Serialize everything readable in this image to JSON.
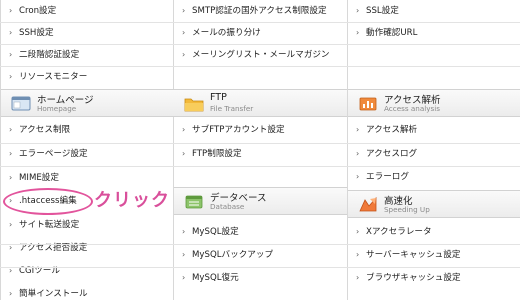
{
  "col1": {
    "items_top": [
      "Cron設定",
      "SSH設定",
      "二段階認証設定",
      "リソースモニター"
    ],
    "section_homepage": {
      "title": "ホームページ",
      "subtitle": "Homepage",
      "icon": "homepage-icon"
    },
    "items_homepage": [
      "アクセス制限",
      "エラーページ設定",
      "MIME設定",
      ".htaccess編集",
      "サイト転送設定",
      "アクセス拒否設定",
      "CGIツール",
      "簡単インストール"
    ]
  },
  "col2": {
    "items_top": [
      "SMTP認証の国外アクセス制限設定",
      "メールの振り分け",
      "メーリングリスト・メールマガジン"
    ],
    "section_ftp": {
      "title": "FTP",
      "subtitle": "File Transfer",
      "icon": "folder-icon"
    },
    "items_ftp": [
      "サブFTPアカウント設定",
      "FTP制限設定"
    ],
    "section_db": {
      "title": "データベース",
      "subtitle": "Database",
      "icon": "database-icon"
    },
    "items_db": [
      "MySQL設定",
      "MySQLバックアップ",
      "MySQL復元"
    ]
  },
  "col3": {
    "items_top": [
      "SSL設定",
      "動作確認URL"
    ],
    "section_access": {
      "title": "アクセス解析",
      "subtitle": "Access analysis",
      "icon": "chart-icon"
    },
    "items_access": [
      "アクセス解析",
      "アクセスログ",
      "エラーログ"
    ],
    "section_speed": {
      "title": "高速化",
      "subtitle": "Speeding Up",
      "icon": "speed-icon"
    },
    "items_speed": [
      "Xアクセラレータ",
      "サーバーキャッシュ設定",
      "ブラウザキャッシュ設定"
    ]
  },
  "annotation": {
    "text": "クリック",
    "color": "#d94f9b"
  },
  "arrow_glyph": "›"
}
